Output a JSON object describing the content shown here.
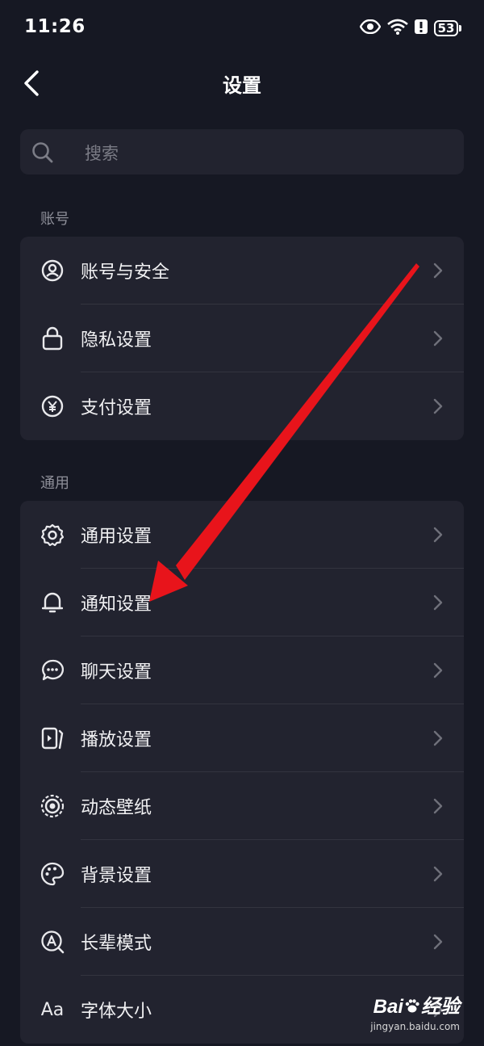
{
  "status_bar": {
    "time": "11:26",
    "battery": "53"
  },
  "header": {
    "title": "设置"
  },
  "search": {
    "placeholder": "搜索"
  },
  "sections": [
    {
      "title": "账号",
      "items": [
        {
          "label": "账号与安全",
          "icon": "person-circle-icon"
        },
        {
          "label": "隐私设置",
          "icon": "lock-icon"
        },
        {
          "label": "支付设置",
          "icon": "yen-circle-icon"
        }
      ]
    },
    {
      "title": "通用",
      "items": [
        {
          "label": "通用设置",
          "icon": "gear-icon"
        },
        {
          "label": "通知设置",
          "icon": "bell-icon"
        },
        {
          "label": "聊天设置",
          "icon": "chat-bubble-icon"
        },
        {
          "label": "播放设置",
          "icon": "play-device-icon"
        },
        {
          "label": "动态壁纸",
          "icon": "dynamic-wallpaper-icon"
        },
        {
          "label": "背景设置",
          "icon": "palette-icon"
        },
        {
          "label": "长辈模式",
          "icon": "elder-mode-icon"
        },
        {
          "label": "字体大小",
          "icon": "font-size-icon",
          "icon_text": "Aa"
        }
      ]
    }
  ],
  "watermark": {
    "logo": "Bai",
    "logo_suffix": "经验",
    "url": "jingyan.baidu.com"
  },
  "colors": {
    "background": "#161823",
    "card": "#22232f",
    "annotation_arrow": "#e8141b"
  }
}
